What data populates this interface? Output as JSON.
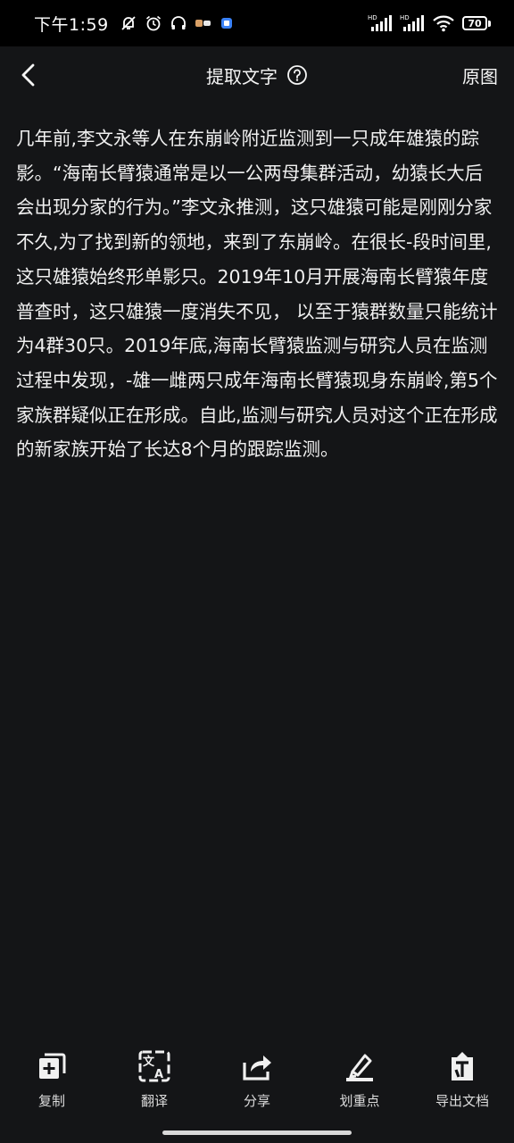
{
  "status_bar": {
    "time": "下午1:59",
    "network_1": "HD",
    "network_2": "HD",
    "battery": "70"
  },
  "header": {
    "title": "提取文字",
    "original_label": "原图"
  },
  "content": {
    "text": "几年前,李文永等人在东崩岭附近监测到一只成年雄猿的踪影。“海南长臂猿通常是以一公两母集群活动，幼猿长大后会出现分家的行为。”李文永推测，这只雄猿可能是刚刚分家不久,为了找到新的领地，来到了东崩岭。在很长-段时间里,这只雄猿始终形单影只。2019年10月开展海南长臂猿年度普查时，这只雄猿一度消失不见， 以至于猿群数量只能统计为4群30只。2019年底,海南长臂猿监测与研究人员在监测过程中发现，-雄一雌两只成年海南长臂猿现身东崩岭,第5个家族群疑似正在形成。自此,监测与研究人员对这个正在形成的新家族开始了长达8个月的跟踪监测。"
  },
  "toolbar": {
    "copy_label": "复制",
    "translate_label": "翻译",
    "share_label": "分享",
    "highlight_label": "划重点",
    "export_label": "导出文档"
  }
}
